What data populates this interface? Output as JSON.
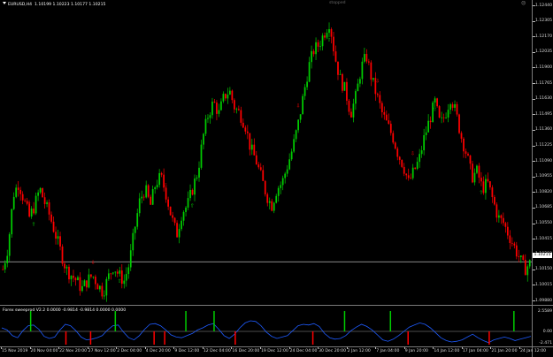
{
  "chart_header": {
    "symbol_label": "EURUSD,H4",
    "ohlc": "1.10199 1.10223 1.10177 1.10215",
    "status": "stopped"
  },
  "indicator": {
    "label": "Forex sweeprod V2.2 0.0000 -0.9814 -0.9814 0.0000 0.0000",
    "axis_top": "2.5589",
    "axis_mid": "0.00",
    "axis_bottom": "-2.471"
  },
  "current_price": "1.10215",
  "price_axis": [
    "1.12440",
    "1.12305",
    "1.12170",
    "1.12035",
    "1.11900",
    "1.11765",
    "1.11630",
    "1.11495",
    "1.11360",
    "1.11225",
    "1.11090",
    "1.10955",
    "1.10820",
    "1.10685",
    "1.10550",
    "1.10415",
    "1.10280",
    "1.10150",
    "1.10015",
    "1.09880"
  ],
  "time_axis": [
    "15 Nov 2019",
    "20 Nov 04:00",
    "22 Nov 20:00",
    "27 Nov 12:00",
    "2 Dec 04:00",
    "4 Dec 20:00",
    "9 Dec 12:00",
    "12 Dec 04:00",
    "16 Dec 20:00",
    "19 Dec 12:00",
    "24 Dec 04:00",
    "30 Dec 20:00",
    "2 Jan 12:00",
    "7 Jan 04:00",
    "9 Jan 20:00",
    "14 Jan 12:00",
    "17 Jan 04:00",
    "21 Jan 20:00",
    "24 Jan 12:00"
  ],
  "colors": {
    "bull": "#00cc00",
    "bear": "#ff0000",
    "line": "#1e5bff",
    "grid": "#9a9a9a"
  },
  "chart_data": {
    "type": "candlestick",
    "symbol": "EURUSD",
    "timeframe": "H4",
    "ylim": [
      1.0988,
      1.1244
    ],
    "close_path": [
      1.1015,
      1.1035,
      1.108,
      1.109,
      1.1075,
      1.106,
      1.107,
      1.1085,
      1.1072,
      1.106,
      1.1045,
      1.103,
      1.1015,
      1.101,
      1.1005,
      1.0998,
      1.1005,
      1.101,
      1.1002,
      1.0995,
      1.1008,
      1.1018,
      1.101,
      1.1005,
      1.102,
      1.105,
      1.1075,
      1.1085,
      1.107,
      1.109,
      1.1095,
      1.108,
      1.106,
      1.1045,
      1.1065,
      1.107,
      1.1085,
      1.11,
      1.113,
      1.115,
      1.116,
      1.115,
      1.1165,
      1.117,
      1.1155,
      1.115,
      1.114,
      1.112,
      1.111,
      1.1095,
      1.108,
      1.107,
      1.1085,
      1.109,
      1.1105,
      1.112,
      1.114,
      1.1165,
      1.119,
      1.1205,
      1.121,
      1.122,
      1.123,
      1.12,
      1.118,
      1.117,
      1.115,
      1.1165,
      1.119,
      1.12,
      1.118,
      1.1165,
      1.115,
      1.114,
      1.113,
      1.1115,
      1.1105,
      1.109,
      1.11,
      1.111,
      1.113,
      1.1145,
      1.116,
      1.114,
      1.115,
      1.1165,
      1.115,
      1.113,
      1.1115,
      1.1095,
      1.11,
      1.1085,
      1.109,
      1.1075,
      1.106,
      1.1055,
      1.1045,
      1.1035,
      1.1025,
      1.1015,
      1.102
    ],
    "arrows_up": [
      6,
      22,
      36,
      62,
      82,
      91
    ],
    "arrows_down": [
      5,
      17,
      31,
      56,
      71,
      78
    ],
    "indicator_line": [
      0.5,
      0.2,
      -0.6,
      -0.9,
      0.1,
      0.8,
      0.9,
      0.3,
      -0.7,
      -1.0,
      -0.8,
      0.2,
      1.0,
      0.8,
      0.1,
      -0.8,
      -1.2,
      -1.1,
      -0.9,
      -0.6,
      0.2,
      0.8,
      0.9,
      -0.1,
      -0.9,
      -1.2,
      -0.6,
      0.3,
      1.0,
      1.1,
      0.8,
      0.2,
      -0.5,
      -0.8,
      -0.9,
      -0.6,
      -0.3,
      0.2,
      0.5,
      0.9,
      1.1,
      0.3,
      -0.6,
      -1.0,
      -0.4,
      0.5,
      1.2,
      1.5,
      1.4,
      0.8,
      -0.1,
      -0.7,
      -1.0,
      -0.8,
      -0.6,
      0.1,
      0.8,
      1.0,
      0.9,
      1.1,
      0.7,
      -0.3,
      -0.9,
      -1.1,
      -1.0,
      -0.6,
      0.1,
      0.6,
      1.0,
      0.7,
      0.2,
      -0.5,
      -1.2,
      -1.4,
      -1.1,
      -0.6,
      0.0,
      0.6,
      0.9,
      1.2,
      1.0,
      0.5,
      -0.2,
      -0.9,
      -1.3,
      -1.5,
      -1.4,
      -1.2,
      -0.8,
      -0.4,
      -0.9,
      -1.3,
      -1.6,
      -1.2,
      -1.0,
      -0.8,
      -1.0,
      -1.3,
      -1.1,
      -0.9,
      -0.7
    ],
    "indicator_green_bars": [
      8,
      32,
      52,
      60,
      97,
      110,
      145
    ],
    "indicator_red_bars": [
      18,
      25,
      43,
      46,
      66,
      88,
      115,
      138
    ]
  }
}
